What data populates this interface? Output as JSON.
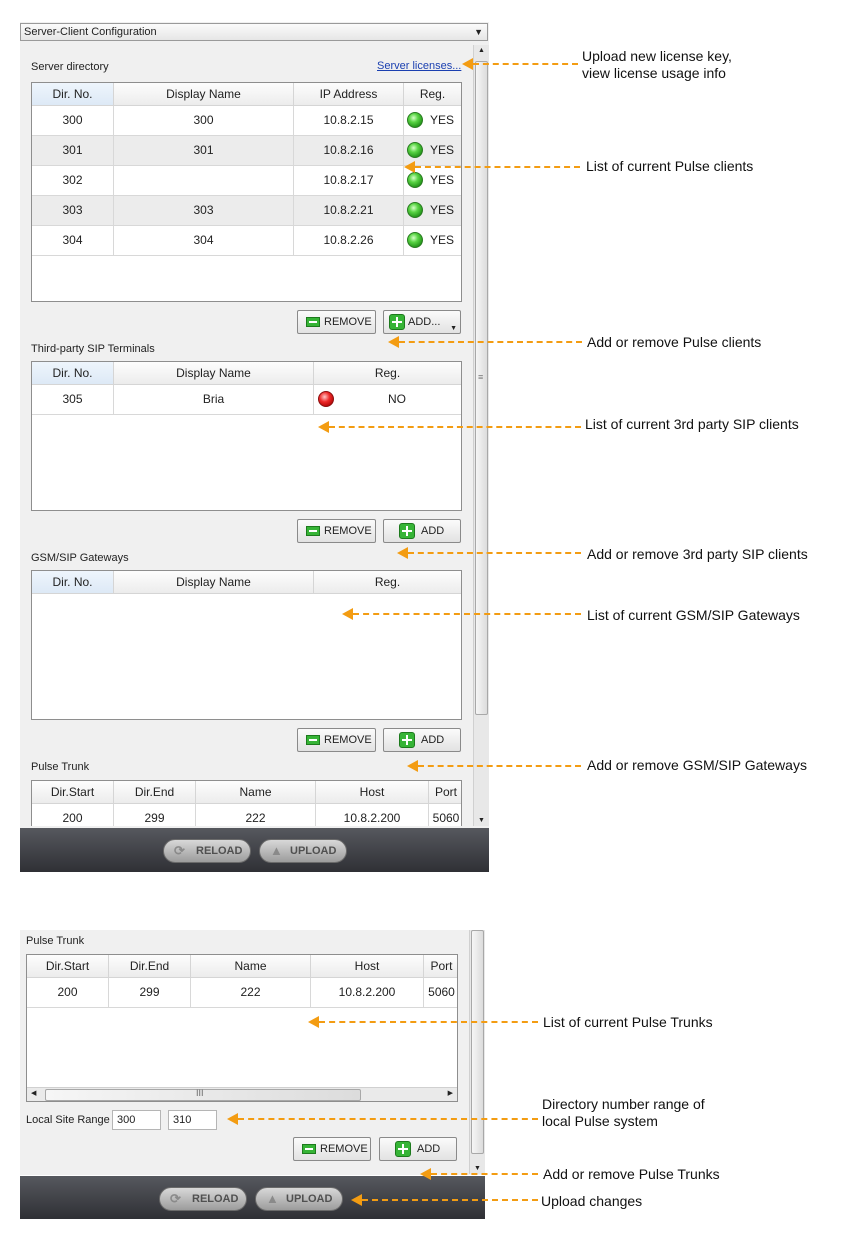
{
  "top_panel": {
    "dropdown": "Server-Client Configuration",
    "server_directory": {
      "title": "Server directory",
      "licenses_link": "Server licenses...",
      "columns": [
        "Dir. No.",
        "Display Name",
        "IP Address",
        "Reg."
      ],
      "rows": [
        {
          "dir": "300",
          "name": "300",
          "ip": "10.8.2.15",
          "reg": "YES"
        },
        {
          "dir": "301",
          "name": "301",
          "ip": "10.8.2.16",
          "reg": "YES"
        },
        {
          "dir": "302",
          "name": "",
          "ip": "10.8.2.17",
          "reg": "YES"
        },
        {
          "dir": "303",
          "name": "303",
          "ip": "10.8.2.21",
          "reg": "YES"
        },
        {
          "dir": "304",
          "name": "304",
          "ip": "10.8.2.26",
          "reg": "YES"
        }
      ],
      "remove": "REMOVE",
      "add": "ADD..."
    },
    "third_party": {
      "title": "Third-party SIP Terminals",
      "columns": [
        "Dir. No.",
        "Display Name",
        "Reg."
      ],
      "rows": [
        {
          "dir": "305",
          "name": "Bria",
          "reg": "NO"
        }
      ],
      "remove": "REMOVE",
      "add": "ADD"
    },
    "gateways": {
      "title": "GSM/SIP Gateways",
      "columns": [
        "Dir. No.",
        "Display Name",
        "Reg."
      ],
      "remove": "REMOVE",
      "add": "ADD"
    },
    "pulse_trunk": {
      "title": "Pulse Trunk",
      "columns": [
        "Dir.Start",
        "Dir.End",
        "Name",
        "Host",
        "Port"
      ],
      "rows": [
        {
          "start": "200",
          "end": "299",
          "name": "222",
          "host": "10.8.2.200",
          "port": "5060"
        }
      ]
    },
    "footer": {
      "reload": "RELOAD",
      "upload": "UPLOAD"
    }
  },
  "bottom_panel": {
    "pulse_trunk": {
      "title": "Pulse Trunk",
      "columns": [
        "Dir.Start",
        "Dir.End",
        "Name",
        "Host",
        "Port"
      ],
      "rows": [
        {
          "start": "200",
          "end": "299",
          "name": "222",
          "host": "10.8.2.200",
          "port": "5060"
        }
      ],
      "hscroll_grip": "III"
    },
    "local_site_range": {
      "label": "Local Site Range",
      "from": "300",
      "to": "310"
    },
    "remove": "REMOVE",
    "add": "ADD",
    "footer": {
      "reload": "RELOAD",
      "upload": "UPLOAD"
    }
  },
  "annotations": {
    "license": [
      "Upload new license key,",
      "view license usage info"
    ],
    "pulse_clients": "List of current Pulse clients",
    "add_remove_pulse": "Add or remove Pulse clients",
    "third_party_list": "List of current 3rd party SIP clients",
    "add_remove_third": "Add or remove 3rd party SIP clients",
    "gateways_list": "List of current GSM/SIP Gateways",
    "add_remove_gateways": "Add or remove GSM/SIP Gateways",
    "trunks_list": "List of current Pulse Trunks",
    "range": [
      "Directory number range of",
      "local Pulse system"
    ],
    "add_remove_trunks": "Add or remove Pulse Trunks",
    "upload_changes": "Upload changes"
  },
  "colors": {
    "accent_arrow": "#f39c12",
    "footer_bg": "#3b3c41",
    "link": "#1a3fb0"
  }
}
